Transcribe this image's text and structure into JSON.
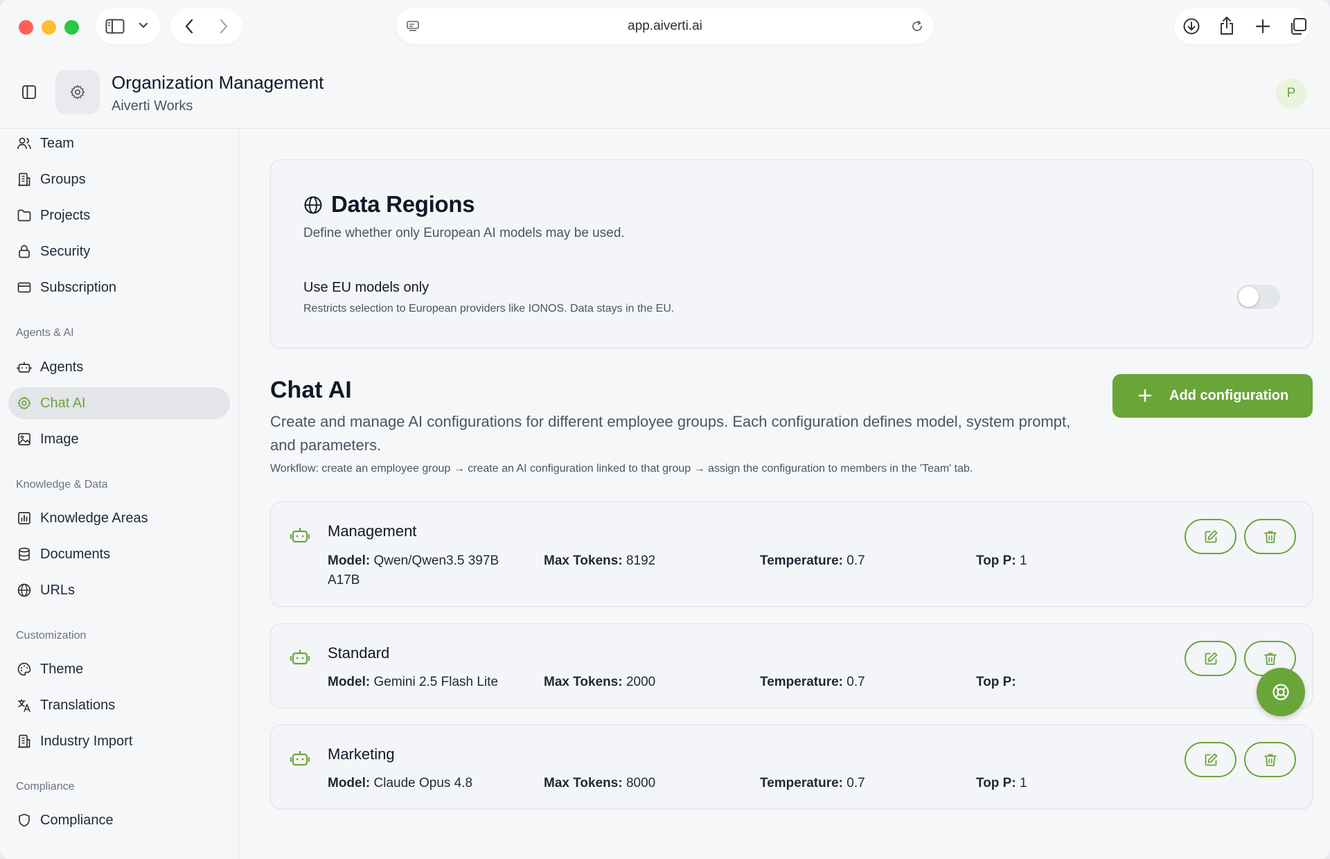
{
  "browser": {
    "url": "app.aiverti.ai"
  },
  "header": {
    "title": "Organization Management",
    "subtitle": "Aiverti Works",
    "avatar_initial": "P"
  },
  "sidebar": {
    "items_top": [
      {
        "label": "Team",
        "icon": "users-icon"
      },
      {
        "label": "Groups",
        "icon": "building-icon"
      },
      {
        "label": "Projects",
        "icon": "folder-icon"
      },
      {
        "label": "Security",
        "icon": "lock-icon"
      },
      {
        "label": "Subscription",
        "icon": "credit-card-icon"
      }
    ],
    "sections": {
      "agents_ai": "Agents & AI",
      "knowledge_data": "Knowledge & Data",
      "customization": "Customization",
      "compliance": "Compliance"
    },
    "agents_items": [
      {
        "label": "Agents",
        "icon": "bot-icon"
      },
      {
        "label": "Chat AI",
        "icon": "gear-icon",
        "active": true
      },
      {
        "label": "Image",
        "icon": "image-icon"
      }
    ],
    "knowledge_items": [
      {
        "label": "Knowledge Areas",
        "icon": "chart-icon"
      },
      {
        "label": "Documents",
        "icon": "database-icon"
      },
      {
        "label": "URLs",
        "icon": "globe-icon"
      }
    ],
    "customization_items": [
      {
        "label": "Theme",
        "icon": "palette-icon"
      },
      {
        "label": "Translations",
        "icon": "translate-icon"
      },
      {
        "label": "Industry Import",
        "icon": "building-icon"
      }
    ],
    "compliance_items": [
      {
        "label": "Compliance",
        "icon": "shield-icon"
      }
    ]
  },
  "data_regions": {
    "title": "Data Regions",
    "description": "Define whether only European AI models may be used.",
    "eu_toggle": {
      "label": "Use EU models only",
      "description": "Restricts selection to European providers like IONOS. Data stays in the EU.",
      "enabled": false
    }
  },
  "chat_ai": {
    "title": "Chat AI",
    "description": "Create and manage AI configurations for different employee groups. Each configuration defines model, system prompt, and parameters.",
    "workflow": "Workflow: create an employee group → create an AI configuration linked to that group → assign the configuration to members in the 'Team' tab.",
    "add_button": "Add configuration",
    "field_labels": {
      "model": "Model:",
      "max_tokens": "Max Tokens:",
      "temperature": "Temperature:",
      "top_p": "Top P:"
    },
    "configs": [
      {
        "name": "Management",
        "model_line1": "Qwen/Qwen3.5 397B",
        "model_line2": "A17B",
        "max_tokens": "8192",
        "temperature": "0.7",
        "top_p": "1"
      },
      {
        "name": "Standard",
        "model_line1": "Gemini 2.5 Flash Lite",
        "max_tokens": "2000",
        "temperature": "0.7",
        "top_p": ""
      },
      {
        "name": "Marketing",
        "model_line1": "Claude Opus 4.8",
        "max_tokens": "8000",
        "temperature": "0.7",
        "top_p": "1"
      }
    ]
  },
  "colors": {
    "accent": "#6aa53a",
    "accent_light": "#e9f3de",
    "active_nav_bg": "#e3e5e8"
  }
}
